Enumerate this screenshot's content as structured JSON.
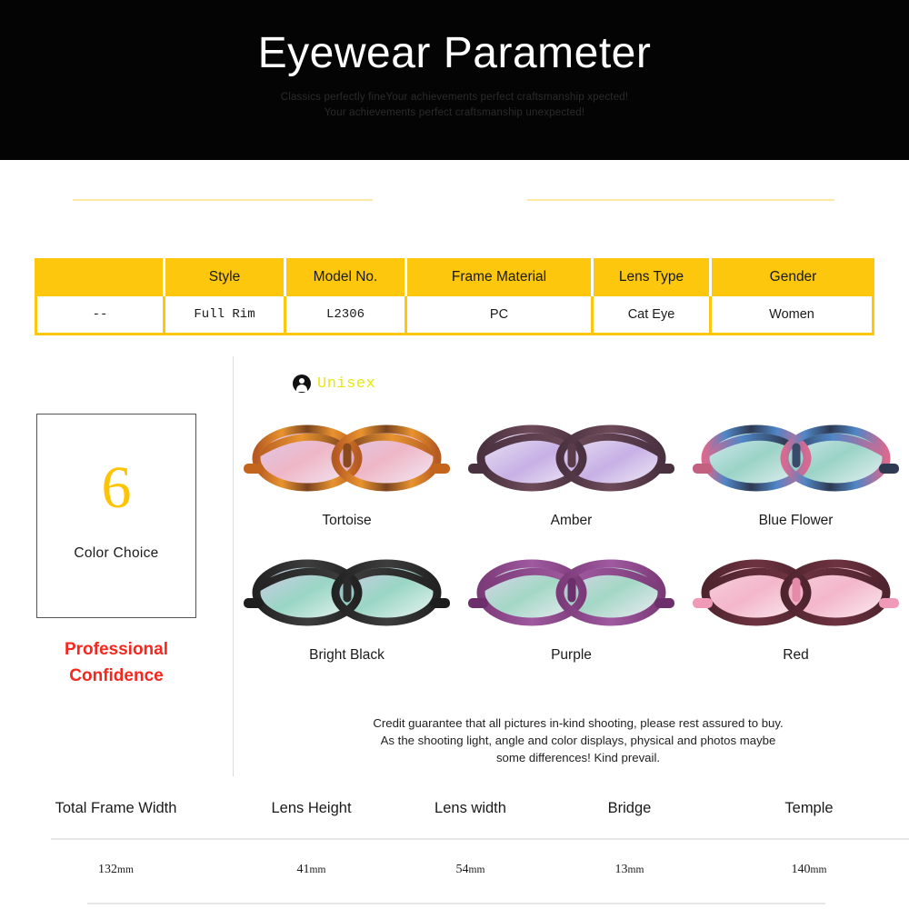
{
  "hero": {
    "title": "Eyewear Parameter",
    "subtitle_line1": "Classics perfectly fineYour  achievements perfect craftsmanship xpected!",
    "subtitle_line2": "Your achievements perfect craftsmanship unexpected!",
    "background_color": "#040404",
    "title_color": "#ffffff"
  },
  "accent": {
    "yellow": "#fcc70d",
    "pale_yellow": "#fbe9a4",
    "red": "#f5271e",
    "badge_yellow": "#e8e80c",
    "number_yellow": "#ffc400"
  },
  "spec_table": {
    "headers": [
      "",
      "Style",
      "Model No.",
      "Frame Material",
      "Lens Type",
      "Gender"
    ],
    "values": [
      "--",
      "Full Rim",
      "L2306",
      "PC",
      "Cat Eye",
      "Women"
    ]
  },
  "unisex": {
    "icon": "user-icon",
    "label": "Unisex"
  },
  "color_choice": {
    "count": "6",
    "label": "Color Choice",
    "tagline_line1": "Professional",
    "tagline_line2": "Confidence"
  },
  "colors": [
    {
      "name": "Tortoise",
      "frame": "#c4651e",
      "accent": "#e08a3c",
      "temple": "#b65bd0"
    },
    {
      "name": "Amber",
      "frame": "#5a3b4a",
      "accent": "#8c6a78",
      "temple": "#a98ad0"
    },
    {
      "name": "Blue Flower",
      "frame": "#3a4a6a",
      "accent": "#4f86c6",
      "temple": "#4fb0a0"
    },
    {
      "name": "Bright Black",
      "frame": "#2b2b2b",
      "accent": "#4a4a4a",
      "temple": "#46b89a"
    },
    {
      "name": "Purple",
      "frame": "#7b3a78",
      "accent": "#a05aa0",
      "temple": "#6fc0a8"
    },
    {
      "name": "Red",
      "frame": "#5c2a34",
      "accent": "#e58aa8",
      "temple": "#f09ab4"
    }
  ],
  "disclaimer": {
    "line1": "Credit guarantee that all pictures in-kind shooting, please rest assured to buy.",
    "line2": "As the shooting light, angle and color displays, physical and photos maybe",
    "line3": "some differences! Kind prevail."
  },
  "measurements": {
    "headers": [
      "Total Frame Width",
      "Lens Height",
      "Lens width",
      "Bridge",
      "Temple"
    ],
    "values": [
      "132",
      "41",
      "54",
      "13",
      "140"
    ],
    "unit": "mm"
  }
}
